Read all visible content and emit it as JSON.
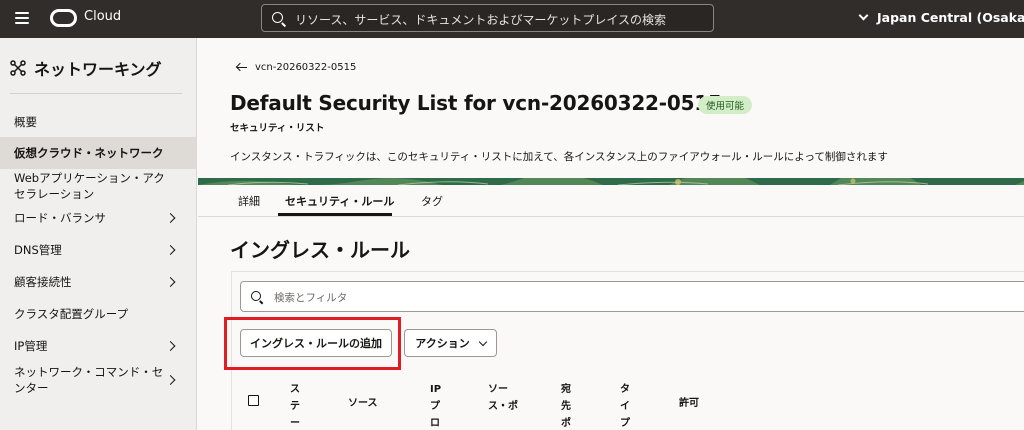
{
  "topbar": {
    "brand": "Cloud",
    "search_placeholder": "リソース、サービス、ドキュメントおよびマーケットプレイスの検索",
    "region": "Japan Central (Osaka)"
  },
  "sidebar": {
    "title": "ネットワーキング",
    "items": [
      {
        "label": "概要"
      },
      {
        "label": "仮想クラウド・ネットワーク"
      },
      {
        "label": "Webアプリケーション・アクセラレーション"
      },
      {
        "label": "ロード・バランサ"
      },
      {
        "label": "DNS管理"
      },
      {
        "label": "顧客接続性"
      },
      {
        "label": "クラスタ配置グループ"
      },
      {
        "label": "IP管理"
      },
      {
        "label": "ネットワーク・コマンド・センター"
      }
    ]
  },
  "main": {
    "breadcrumb": "vcn-20260322-0515",
    "title": "Default Security List for vcn-20260322-0515",
    "status_badge": "使用可能",
    "subtitle": "セキュリティ・リスト",
    "description": "インスタンス・トラフィックは、このセキュリティ・リストに加えて、各インスタンス上のファイアウォール・ルールによって制御されます",
    "tabs": [
      {
        "label": "詳細"
      },
      {
        "label": "セキュリティ・ルール"
      },
      {
        "label": "タグ"
      }
    ],
    "section_title": "イングレス・ルール",
    "filter_placeholder": "検索とフィルタ",
    "add_button": "イングレス・ルールの追加",
    "actions_button": "アクション",
    "columns": [
      {
        "label": "ステー"
      },
      {
        "label": "ソース"
      },
      {
        "label": "IPプロ"
      },
      {
        "label": "ソース・ポ"
      },
      {
        "label": "宛先ポ"
      },
      {
        "label": "タイプ"
      },
      {
        "label": "許可"
      }
    ]
  },
  "colors": {
    "topbar_bg": "#312d2a",
    "highlight_border": "#e01d24",
    "badge_bg": "#d4edc9",
    "sidebar_active_bg": "#dedad6"
  }
}
